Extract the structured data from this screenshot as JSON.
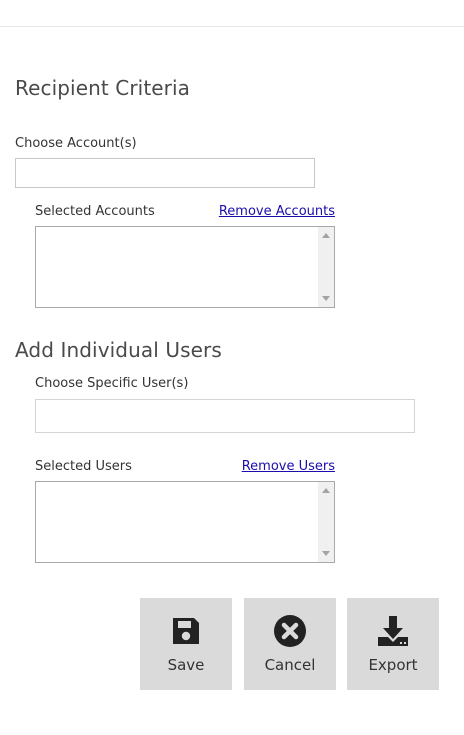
{
  "recipient": {
    "title": "Recipient Criteria",
    "choose_accounts_label": "Choose Account(s)",
    "choose_accounts_value": "",
    "selected_accounts_label": "Selected Accounts",
    "remove_accounts_link": "Remove Accounts"
  },
  "individual": {
    "title": "Add Individual Users",
    "choose_users_label": "Choose Specific User(s)",
    "choose_users_value": "",
    "selected_users_label": "Selected Users",
    "remove_users_link": "Remove Users"
  },
  "actions": {
    "save_label": "Save",
    "cancel_label": "Cancel",
    "export_label": "Export",
    "save_icon": "save-icon",
    "cancel_icon": "cancel-icon",
    "export_icon": "download-icon"
  },
  "colors": {
    "button_bg": "#dadada",
    "link": "#1a0dab",
    "heading": "#4a4a4a"
  }
}
